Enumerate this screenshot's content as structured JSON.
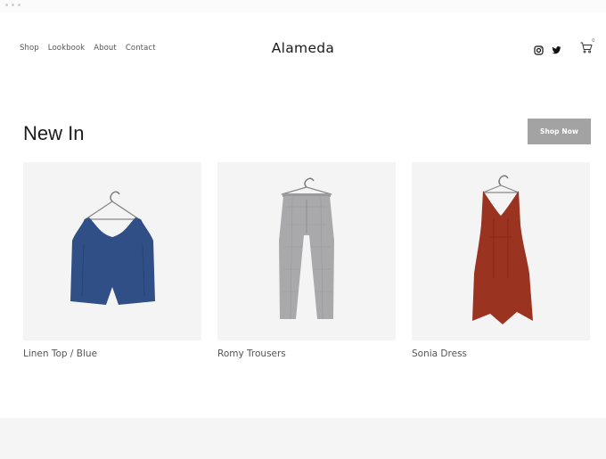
{
  "header": {
    "nav": [
      {
        "label": "Shop"
      },
      {
        "label": "Lookbook"
      },
      {
        "label": "About"
      },
      {
        "label": "Contact"
      }
    ],
    "brand": "Alameda",
    "social_icons": [
      "instagram-icon",
      "twitter-icon"
    ],
    "cart": {
      "icon": "cart-icon",
      "count": "0"
    }
  },
  "section": {
    "title": "New In",
    "cta_label": "Shop Now"
  },
  "products": [
    {
      "name": "Linen Top / Blue",
      "color": "#2f4f86"
    },
    {
      "name": "Romy Trousers",
      "color": "#a9a9ab"
    },
    {
      "name": "Sonia Dress",
      "color": "#9a3320"
    }
  ],
  "colors": {
    "cta_background": "#a3a3a3",
    "product_tile": "#f4f4f4",
    "footer": "#f5f5f5"
  }
}
